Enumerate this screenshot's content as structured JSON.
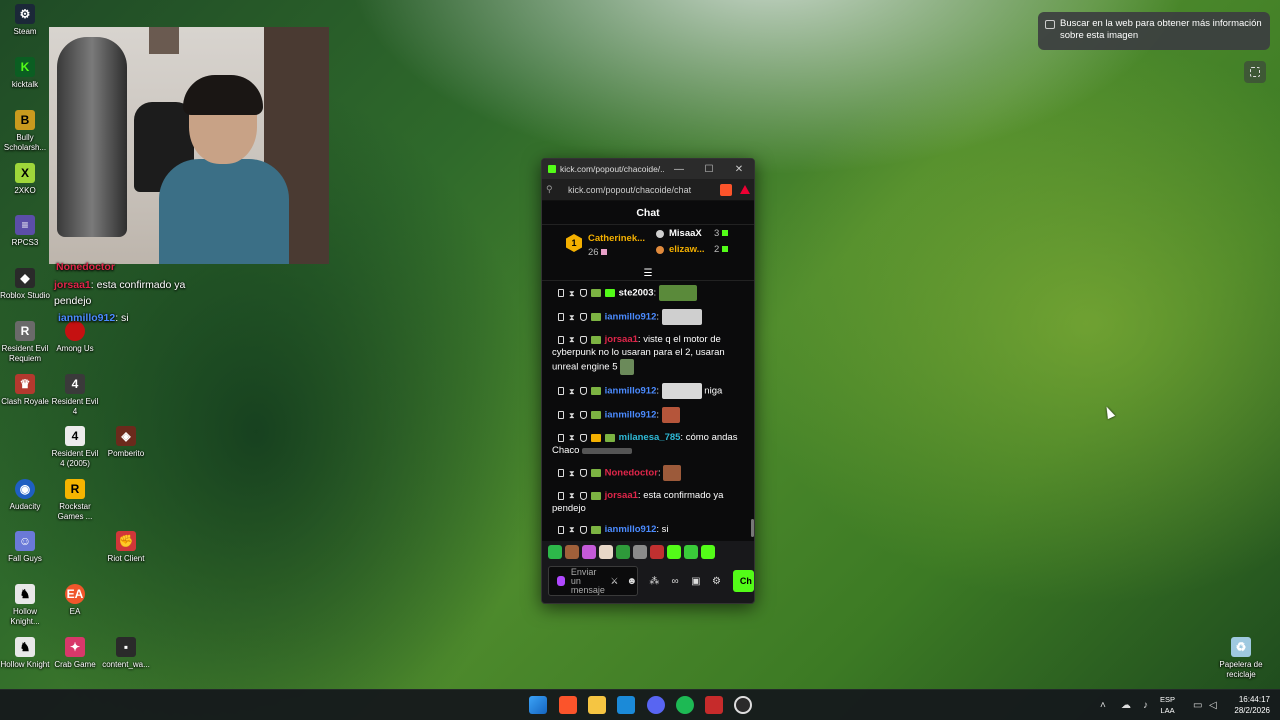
{
  "desktop": {
    "icons": [
      {
        "label": "Steam",
        "icon": "steam-icon",
        "color": "#1b2838"
      },
      {
        "label": "kicktalk",
        "icon": "kick-icon",
        "color": "#0b5e22"
      },
      {
        "label": "Bully Scholarsh...",
        "icon": "bully-icon",
        "color": "#c99a1e"
      },
      {
        "label": "2XKO",
        "icon": "2xko-icon",
        "color": "#9fd63a"
      },
      {
        "label": "RPCS3",
        "icon": "rpcs3-icon",
        "color": "#5b4ea8"
      },
      {
        "label": "Roblox Studio",
        "icon": "roblox-icon",
        "color": "#2a2a2a"
      },
      {
        "label": "Resident Evil Requiem",
        "icon": "re-icon",
        "color": "#6a6a6a"
      },
      {
        "label": "Among Us",
        "icon": "among-us-icon",
        "color": "#c51111"
      },
      {
        "label": "Clash Royale",
        "icon": "clash-royale-icon",
        "color": "#b3392e"
      },
      {
        "label": "Resident Evil 4",
        "icon": "re4-icon",
        "color": "#3a3a3a"
      },
      {
        "label": "Resident Evil 4 (2005)",
        "icon": "re4-2005-icon",
        "color": "#ececec"
      },
      {
        "label": "Pomberito",
        "icon": "pomberito-icon",
        "color": "#6b2a1c"
      },
      {
        "label": "Audacity",
        "icon": "audacity-icon",
        "color": "#1f5fc2"
      },
      {
        "label": "Rockstar Games ...",
        "icon": "rockstar-icon",
        "color": "#f5b400"
      },
      {
        "label": "Fall Guys",
        "icon": "fall-guys-icon",
        "color": "#6a79d8"
      },
      {
        "label": "Riot Client",
        "icon": "riot-icon",
        "color": "#d13639"
      },
      {
        "label": "Hollow Knight...",
        "icon": "hollow-knight-icon",
        "color": "#e8e8e8"
      },
      {
        "label": "EA",
        "icon": "ea-icon",
        "color": "#f0562b"
      },
      {
        "label": "Hollow Knight",
        "icon": "hollow-knight-2-icon",
        "color": "#e8e8e8"
      },
      {
        "label": "Crab Game",
        "icon": "crab-game-icon",
        "color": "#d8386a"
      },
      {
        "label": "content_wa...",
        "icon": "folder-icon",
        "color": "#2a2a2a"
      },
      {
        "label": "Papelera de reciclaje",
        "icon": "recycle-bin-icon",
        "color": "#9fc9e0"
      }
    ],
    "overlay_chat": [
      {
        "user": "Nonedoctor",
        "text": ""
      },
      {
        "user": "jorsaa1",
        "text": "esta confirmado ya"
      },
      {
        "user": "",
        "text": "pendejo"
      },
      {
        "user": "ianmillo912",
        "text": "si"
      }
    ],
    "lens_tip": "Buscar en la web para obtener más información sobre esta imagen"
  },
  "popup": {
    "title": "kick.com/popout/chacoide/...",
    "url": "kick.com/popout/chacoide/chat",
    "chat_title": "Chat",
    "leaderboard": {
      "rank": "1",
      "top_user": "Catherinek...",
      "top_count": "26",
      "rows": [
        {
          "user": "MisaaX",
          "count": "3",
          "color": "#cfcfcf"
        },
        {
          "user": "elizaw...",
          "count": "2",
          "color": "#e08a3c"
        }
      ]
    },
    "messages": [
      {
        "user": "ste2003",
        "cls": "user-green",
        "text": "",
        "emote": "#5a8a3a"
      },
      {
        "user": "ianmillo912",
        "cls": "user-blue",
        "text": "",
        "emote": "#cfcfcf"
      },
      {
        "user": "jorsaa1",
        "cls": "user-red",
        "text": "viste q el motor de cyberpunk no lo usaran para el 2, usaran unreal engine 5",
        "emote": ""
      },
      {
        "user": "ianmillo912",
        "cls": "user-blue",
        "text": "niga",
        "emote": "#d8d8d8"
      },
      {
        "user": "ianmillo912",
        "cls": "user-blue",
        "text": "",
        "emote": "#b5553a"
      },
      {
        "user": "milanesa_785",
        "cls": "user-teal",
        "text": "cómo andas Chaco",
        "emote": ""
      },
      {
        "user": "Nonedoctor",
        "cls": "user-red",
        "text": "",
        "emote": "#9c5a3a"
      },
      {
        "user": "jorsaa1",
        "cls": "user-red",
        "text": "esta confirmado ya pendejo",
        "emote": ""
      },
      {
        "user": "ianmillo912",
        "cls": "user-blue",
        "text": "si",
        "emote": ""
      }
    ],
    "input_placeholder": "Enviar un mensaje",
    "send_label": "Ch"
  },
  "taskbar": {
    "lang_1": "ESP",
    "lang_2": "LAA",
    "time": "16:44:17",
    "date": "28/2/2026",
    "apps": [
      "windows-start-icon",
      "brave-icon",
      "file-explorer-icon",
      "bing-icon",
      "discord-icon",
      "spotify-icon",
      "obs-icon",
      "chrome-icon"
    ]
  },
  "colors": {
    "kick_green": "#53fc18",
    "chat_bg": "#0b0b0c",
    "red_user": "#e0264a",
    "blue_user": "#4b8bff"
  }
}
